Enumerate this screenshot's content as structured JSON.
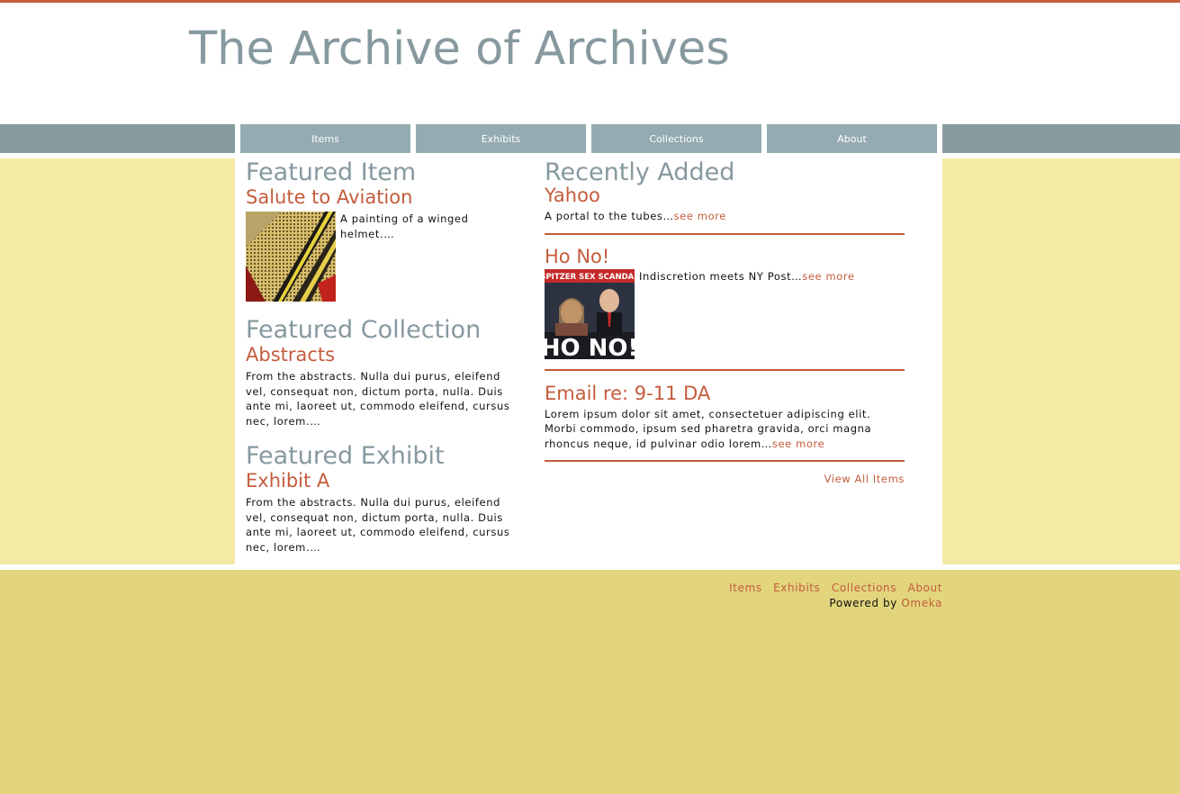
{
  "site": {
    "title": "The Archive of Archives"
  },
  "nav": {
    "items": [
      "Items",
      "Exhibits",
      "Collections",
      "About"
    ]
  },
  "featured_item": {
    "heading": "Featured Item",
    "title": "Salute to Aviation",
    "description": "A painting of a winged helmet.…",
    "image_icon": "winged-helmet-painting"
  },
  "featured_collection": {
    "heading": "Featured Collection",
    "title": "Abstracts",
    "description": "From the abstracts. Nulla dui purus, eleifend vel, consequat non, dictum porta, nulla. Duis ante mi, laoreet ut, commodo eleifend, cursus nec, lorem.…"
  },
  "featured_exhibit": {
    "heading": "Featured Exhibit",
    "title": "Exhibit A",
    "description": "From the abstracts. Nulla dui purus, eleifend vel, consequat non, dictum porta, nulla. Duis ante mi, laoreet ut, commodo eleifend, cursus nec, lorem.…"
  },
  "recent": {
    "heading": "Recently Added",
    "see_more": "see more",
    "items": [
      {
        "title": "Yahoo",
        "description": "A portal to the tubes…"
      },
      {
        "title": "Ho No!",
        "description": "Indiscretion meets NY Post…",
        "image": {
          "banner": "SPITZER SEX SCANDAL",
          "headline": "HO NO!"
        }
      },
      {
        "title": "Email re: 9-11 DA",
        "description": "Lorem ipsum dolor sit amet, consectetuer adipiscing elit. Morbi commodo, ipsum sed pharetra gravida, orci magna rhoncus neque, id pulvinar odio lorem…"
      }
    ],
    "view_all": "View All Items"
  },
  "footer": {
    "links": [
      "Items",
      "Exhibits",
      "Collections",
      "About"
    ],
    "powered_by": "Powered by",
    "powered_link": "Omeka"
  },
  "colors": {
    "accent": "#c45c3c",
    "heading": "#86999f",
    "nav": "#94abb1",
    "side": "#f4eaa4",
    "footer": "#e2d57c"
  }
}
